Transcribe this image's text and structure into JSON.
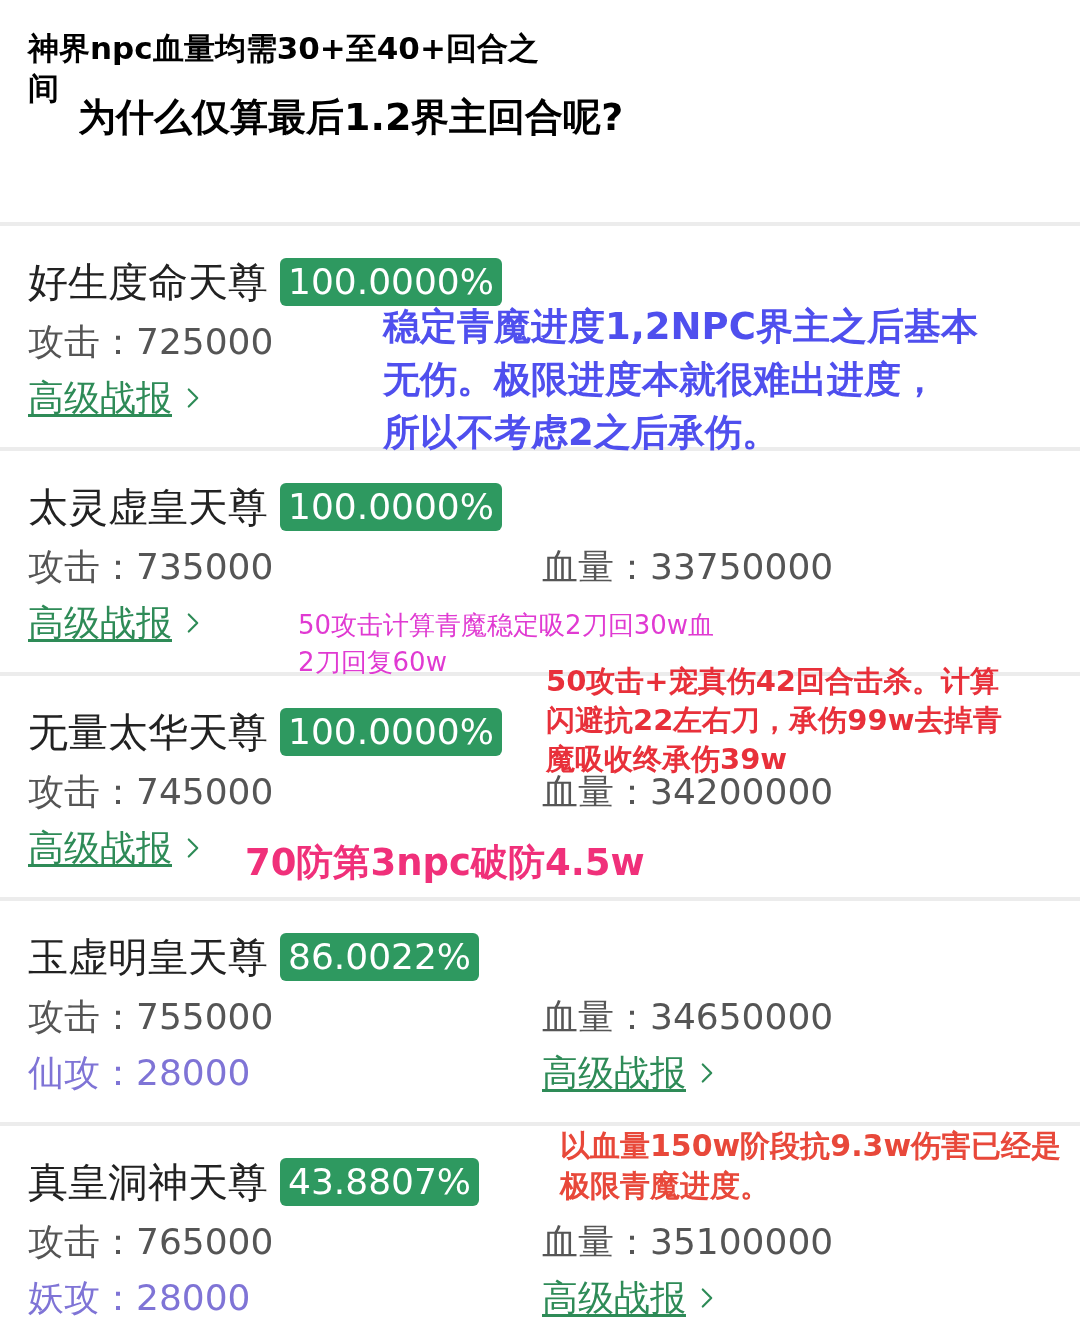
{
  "header": {
    "title": "神界npc血量均需30+至40+回合之间",
    "question": "为什么仅算最后1.2界主回合呢?"
  },
  "bosses": [
    {
      "name": "好生度命天尊",
      "progress": "100.0000%",
      "rows": [
        [
          {
            "kind": "stat",
            "label": "攻击：",
            "value": "725000"
          }
        ],
        [
          {
            "kind": "link",
            "label": "高级战报"
          }
        ]
      ]
    },
    {
      "name": "太灵虚皇天尊",
      "progress": "100.0000%",
      "rows": [
        [
          {
            "kind": "stat",
            "label": "攻击：",
            "value": "735000"
          },
          {
            "kind": "stat",
            "label": "血量：",
            "value": "33750000"
          }
        ],
        [
          {
            "kind": "link",
            "label": "高级战报"
          }
        ]
      ]
    },
    {
      "name": "无量太华天尊",
      "progress": "100.0000%",
      "rows": [
        [
          {
            "kind": "stat",
            "label": "攻击：",
            "value": "745000"
          },
          {
            "kind": "stat",
            "label": "血量：",
            "value": "34200000"
          }
        ],
        [
          {
            "kind": "link",
            "label": "高级战报"
          }
        ]
      ]
    },
    {
      "name": "玉虚明皇天尊",
      "progress": "86.0022%",
      "rows": [
        [
          {
            "kind": "stat",
            "label": "攻击：",
            "value": "755000"
          },
          {
            "kind": "stat",
            "label": "血量：",
            "value": "34650000"
          }
        ],
        [
          {
            "kind": "special",
            "label": "仙攻：",
            "value": "28000"
          },
          {
            "kind": "link",
            "label": "高级战报"
          }
        ]
      ]
    },
    {
      "name": "真皇洞神天尊",
      "progress": "43.8807%",
      "rows": [
        [
          {
            "kind": "stat",
            "label": "攻击：",
            "value": "765000"
          },
          {
            "kind": "stat",
            "label": "血量：",
            "value": "35100000"
          }
        ],
        [
          {
            "kind": "special",
            "label": "妖攻：",
            "value": "28000"
          },
          {
            "kind": "link",
            "label": "高级战报"
          }
        ]
      ]
    }
  ],
  "annotations": [
    {
      "color": "#4f4fee",
      "lines": [
        "稳定青魔进度1,2NPC界主之后基本",
        "无伤。极限进度本就很难出进度，",
        "所以不考虑2之后承伤。"
      ]
    },
    {
      "color": "#e03ad2",
      "lines": [
        "50攻击计算青魔稳定吸2刀回30w血",
        "2刀回复60w"
      ]
    },
    {
      "color": "#e8303a",
      "lines": [
        "50攻击+宠真伤42回合击杀。计算",
        "闪避抗22左右刀，承伤99w去掉青",
        "魔吸收终承伤39w"
      ]
    },
    {
      "color": "#f0307a",
      "lines": [
        "70防第3npc破防4.5w"
      ]
    },
    {
      "color": "#e8483a",
      "lines": [
        "以血量150w阶段抗9.3w伤害已经是",
        "极限青魔进度。"
      ]
    }
  ]
}
